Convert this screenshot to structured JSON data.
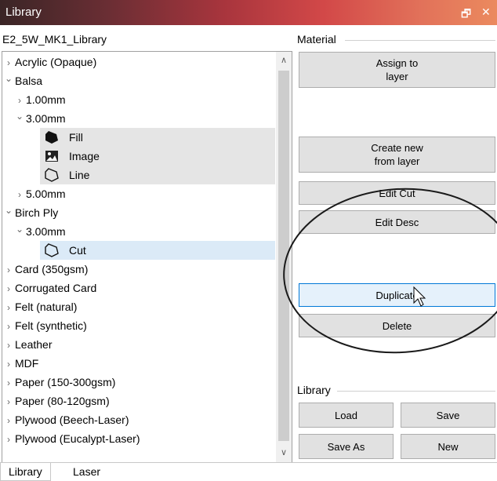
{
  "window": {
    "title": "Library",
    "restore_glyph": "🗗",
    "close_glyph": "✕"
  },
  "library_name": "E2_5W_MK1_Library",
  "tree": [
    {
      "label": "Acrylic (Opaque)",
      "level": 0,
      "expanded": false
    },
    {
      "label": "Balsa",
      "level": 0,
      "expanded": true
    },
    {
      "label": "1.00mm",
      "level": 1,
      "expanded": false
    },
    {
      "label": "3.00mm",
      "level": 1,
      "expanded": true
    },
    {
      "label": "Fill",
      "level": 2,
      "icon": "fill-icon",
      "selected": "grey"
    },
    {
      "label": "Image",
      "level": 2,
      "icon": "image-icon",
      "selected": "grey"
    },
    {
      "label": "Line",
      "level": 2,
      "icon": "line-icon",
      "selected": "grey"
    },
    {
      "label": "5.00mm",
      "level": 1,
      "expanded": false
    },
    {
      "label": "Birch Ply",
      "level": 0,
      "expanded": true
    },
    {
      "label": "3.00mm",
      "level": 1,
      "expanded": true
    },
    {
      "label": "Cut",
      "level": 2,
      "icon": "cut-icon",
      "selected": "blue"
    },
    {
      "label": "Card (350gsm)",
      "level": 0,
      "expanded": false
    },
    {
      "label": "Corrugated Card",
      "level": 0,
      "expanded": false
    },
    {
      "label": "Felt (natural)",
      "level": 0,
      "expanded": false
    },
    {
      "label": "Felt (synthetic)",
      "level": 0,
      "expanded": false
    },
    {
      "label": "Leather",
      "level": 0,
      "expanded": false
    },
    {
      "label": "MDF",
      "level": 0,
      "expanded": false
    },
    {
      "label": "Paper (150-300gsm)",
      "level": 0,
      "expanded": false
    },
    {
      "label": "Paper (80-120gsm)",
      "level": 0,
      "expanded": false
    },
    {
      "label": "Plywood (Beech-Laser)",
      "level": 0,
      "expanded": false
    },
    {
      "label": "Plywood (Eucalypt-Laser)",
      "level": 0,
      "expanded": false
    }
  ],
  "material": {
    "group_label": "Material",
    "assign_label": "Assign to\nlayer",
    "create_label": "Create new\nfrom layer",
    "edit_cut_label": "Edit Cut",
    "edit_desc_label": "Edit Desc",
    "duplicate_label": "Duplicate",
    "delete_label": "Delete"
  },
  "library": {
    "group_label": "Library",
    "load_label": "Load",
    "save_label": "Save",
    "save_as_label": "Save As",
    "new_label": "New"
  },
  "tabs": [
    {
      "label": "Library",
      "active": true
    },
    {
      "label": "Laser",
      "active": false
    }
  ],
  "colors": {
    "highlight_blue": "#dbeaf7",
    "highlight_grey": "#e5e5e5",
    "button_hot_border": "#0078d7"
  }
}
